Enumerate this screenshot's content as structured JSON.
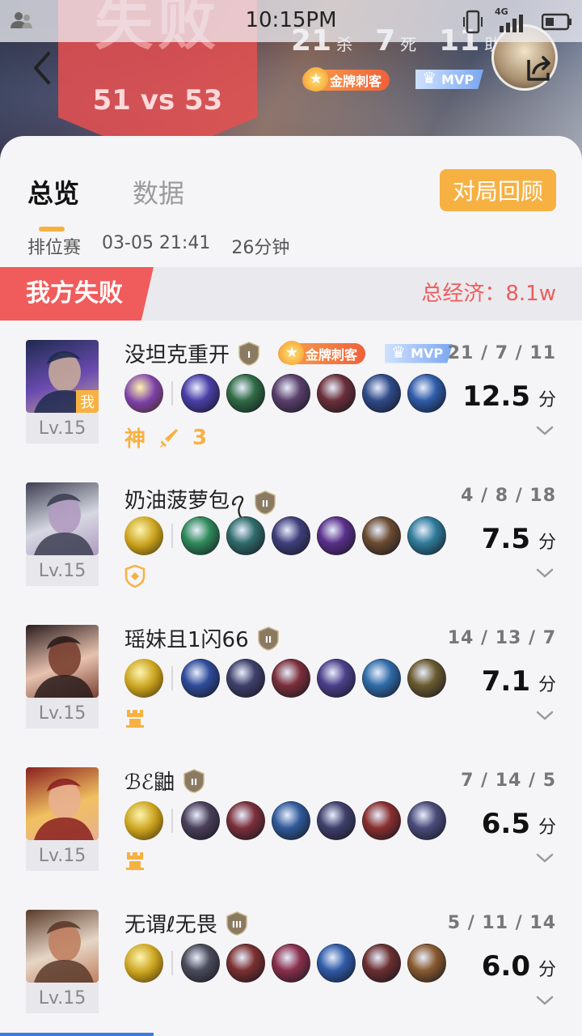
{
  "status_bar": {
    "time": "10:15PM",
    "network": "4G"
  },
  "header": {
    "result": "失败",
    "score": "51 vs 53",
    "kills": "21",
    "kills_label": "杀",
    "deaths": "7",
    "deaths_label": "死",
    "assists": "11",
    "assists_label": "助",
    "badge_gold": "金牌刺客",
    "badge_mvp": "MVP"
  },
  "tabs": [
    {
      "label": "总览",
      "active": true
    },
    {
      "label": "数据",
      "active": false
    }
  ],
  "review_button": "对局回顾",
  "match": {
    "mode": "排位赛",
    "datetime": "03-05 21:41",
    "duration": "26分钟"
  },
  "team": {
    "result_label": "我方失败",
    "economy_label": "总经济：",
    "economy_value": "8.1w"
  },
  "players": [
    {
      "name": "没坦克重开",
      "rank": "I",
      "level": "Lv.15",
      "is_me": true,
      "me_label": "我",
      "tags": [
        "金牌刺客",
        "MVP"
      ],
      "kda": "21 / 7 / 11",
      "score": "12.5",
      "score_unit": "分",
      "extras": [
        "神",
        "sword-icon",
        "3"
      ],
      "spell_color": "#7b3fa8",
      "item_colors": [
        "#4b3fa8",
        "#2f6b44",
        "#5a3f6b",
        "#6b2f3a",
        "#2f4b8a",
        "#2f5ba8"
      ],
      "portrait_colors": [
        "#1e2a4f",
        "#6a4bb0",
        "#c7a89a"
      ]
    },
    {
      "name": "奶油菠萝包ꪖ",
      "rank": "II",
      "level": "Lv.15",
      "is_me": false,
      "tags": [],
      "kda": "4 / 8 / 18",
      "score": "7.5",
      "score_unit": "分",
      "extras": [
        "shield-icon"
      ],
      "spell_color": "#c9a21c",
      "item_colors": [
        "#2f8a5a",
        "#2f6b6b",
        "#3f3f7b",
        "#5a2f8a",
        "#6b4b2f",
        "#2f7b9a"
      ],
      "portrait_colors": [
        "#3d3f52",
        "#d6d8e2",
        "#b09bc0"
      ]
    },
    {
      "name": "瑶妹且1闪66",
      "rank": "II",
      "level": "Lv.15",
      "is_me": false,
      "tags": [],
      "kda": "14 / 13 / 7",
      "score": "7.1",
      "score_unit": "分",
      "extras": [
        "tower-icon"
      ],
      "spell_color": "#c9a21c",
      "item_colors": [
        "#2f4b9a",
        "#3f3f6b",
        "#7b2f3a",
        "#4b3f8a",
        "#2f6ba8",
        "#6b5a2f"
      ],
      "portrait_colors": [
        "#2a1c1c",
        "#e8c2b0",
        "#7a4030"
      ]
    },
    {
      "name": "ℬℰ鼬",
      "rank": "II",
      "level": "Lv.15",
      "is_me": false,
      "tags": [],
      "kda": "7 / 14 / 5",
      "score": "6.5",
      "score_unit": "分",
      "extras": [
        "tower-icon"
      ],
      "spell_color": "#c9a21c",
      "item_colors": [
        "#4b3f5a",
        "#7b2f3a",
        "#2f5a9a",
        "#3f3f6b",
        "#8a2f2f",
        "#4b4b7b"
      ],
      "portrait_colors": [
        "#8a2020",
        "#f0c060",
        "#e8b090"
      ]
    },
    {
      "name": "无谓ℓ无畏",
      "rank": "III",
      "level": "Lv.15",
      "is_me": false,
      "tags": [],
      "kda": "5 / 11 / 14",
      "score": "6.0",
      "score_unit": "分",
      "extras": [],
      "spell_color": "#c9a21c",
      "item_colors": [
        "#4b4b5a",
        "#7b2f2f",
        "#8a2f4b",
        "#2f5ba8",
        "#6b2f2f",
        "#8a5a2f"
      ],
      "portrait_colors": [
        "#5a3a2a",
        "#e6d6c6",
        "#c08060"
      ]
    }
  ]
}
